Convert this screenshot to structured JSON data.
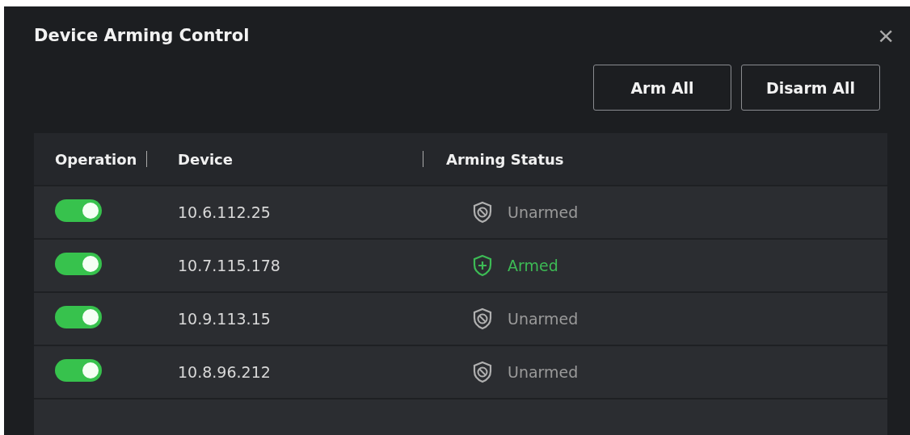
{
  "dialog": {
    "title": "Device Arming Control",
    "close": "×"
  },
  "buttons": [
    "Arm All",
    "Disarm All"
  ],
  "table": {
    "columns": [
      "Operation",
      "Device",
      "Arming Status"
    ],
    "rows": [
      {
        "on": true,
        "device": "10.6.112.25",
        "armed": false,
        "status": "Unarmed"
      },
      {
        "on": true,
        "device": "10.7.115.178",
        "armed": true,
        "status": "Armed"
      },
      {
        "on": true,
        "device": "10.9.113.15",
        "armed": false,
        "status": "Unarmed"
      },
      {
        "on": true,
        "device": "10.8.96.212",
        "armed": false,
        "status": "Unarmed"
      }
    ]
  }
}
